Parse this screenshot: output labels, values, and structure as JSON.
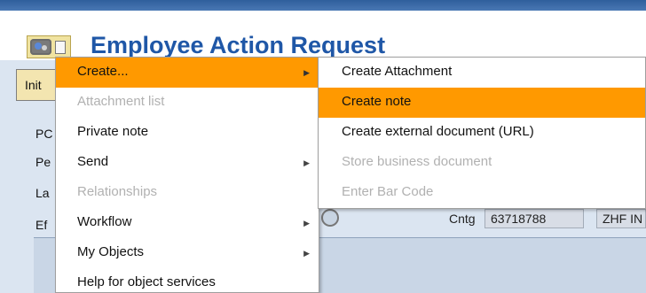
{
  "window": {
    "title": "Employee Action Request"
  },
  "left_panel": {
    "button_label": "Init",
    "labels": [
      "PC",
      "Pe",
      "La",
      "Ef"
    ]
  },
  "fields": {
    "label": "Cntg",
    "value1": "63718788",
    "value2": "ZHF IN"
  },
  "context_menu": {
    "items": [
      {
        "label": "Create...",
        "has_submenu": true,
        "enabled": true,
        "hover": true
      },
      {
        "label": "Attachment list",
        "has_submenu": false,
        "enabled": false,
        "hover": false
      },
      {
        "label": "Private note",
        "has_submenu": false,
        "enabled": true,
        "hover": false
      },
      {
        "label": "Send",
        "has_submenu": true,
        "enabled": true,
        "hover": false
      },
      {
        "label": "Relationships",
        "has_submenu": false,
        "enabled": false,
        "hover": false
      },
      {
        "label": "Workflow",
        "has_submenu": true,
        "enabled": true,
        "hover": false
      },
      {
        "label": "My Objects",
        "has_submenu": true,
        "enabled": true,
        "hover": false
      },
      {
        "label": "Help for object services",
        "has_submenu": false,
        "enabled": true,
        "hover": false
      }
    ]
  },
  "submenu": {
    "items": [
      {
        "label": "Create Attachment",
        "enabled": true,
        "hover": false
      },
      {
        "label": "Create note",
        "enabled": true,
        "hover": true
      },
      {
        "label": "Create external document (URL)",
        "enabled": true,
        "hover": false
      },
      {
        "label": "Store business document",
        "enabled": false,
        "hover": false
      },
      {
        "label": "Enter Bar Code",
        "enabled": false,
        "hover": false
      }
    ]
  },
  "icons": {
    "services": "services-icon",
    "document": "document-icon",
    "submenu_arrow": "chevron-right-icon",
    "circle_button": "help-circle-icon"
  },
  "colors": {
    "title": "#1f57a7",
    "highlight": "#ff9900",
    "topbar": "#2f5f9c",
    "workarea": "#dbe5f1"
  }
}
